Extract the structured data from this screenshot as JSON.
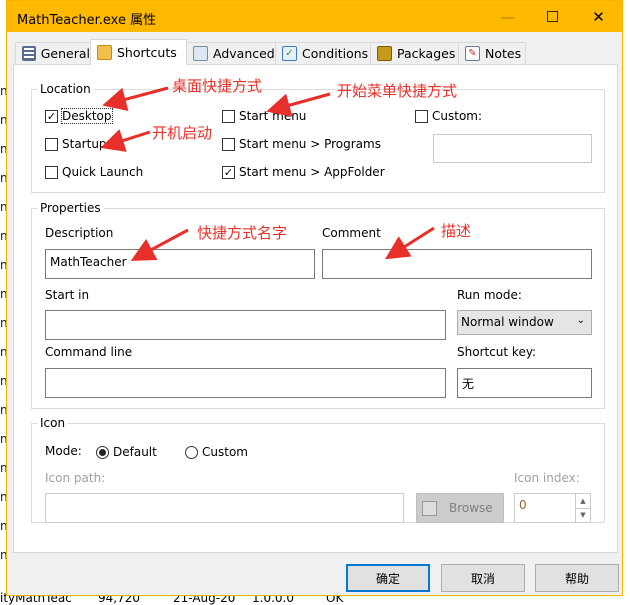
{
  "background": {
    "left_fragment": "ni",
    "bottom_row": [
      "ityMathTeac",
      "94,720",
      "21-Aug-20",
      "1.0.0.0",
      "OK"
    ]
  },
  "window": {
    "title": "MathTeacher.exe 属性",
    "accent": "#ffb900"
  },
  "tabs": [
    {
      "label": "General"
    },
    {
      "label": "Shortcuts",
      "selected": true
    },
    {
      "label": "Advanced"
    },
    {
      "label": "Conditions"
    },
    {
      "label": "Packages"
    },
    {
      "label": "Notes"
    }
  ],
  "location": {
    "legend": "Location",
    "items": [
      {
        "label": "Desktop",
        "checked": true
      },
      {
        "label": "Startup",
        "checked": false
      },
      {
        "label": "Quick Launch",
        "checked": false
      },
      {
        "label": "Start menu",
        "checked": false
      },
      {
        "label": "Start menu > Programs",
        "checked": false
      },
      {
        "label": "Start menu > AppFolder",
        "checked": true
      },
      {
        "label": "Custom:",
        "checked": false
      }
    ],
    "custom_value": ""
  },
  "properties": {
    "legend": "Properties",
    "description_label": "Description",
    "description_value": "MathTeacher",
    "comment_label": "Comment",
    "comment_value": "",
    "start_in_label": "Start in",
    "start_in_value": "",
    "run_mode_label": "Run mode:",
    "run_mode_value": "Normal window",
    "command_line_label": "Command line",
    "command_line_value": "",
    "shortcut_key_label": "Shortcut key:",
    "shortcut_key_value": "无"
  },
  "icon": {
    "legend": "Icon",
    "mode_label": "Mode:",
    "default_label": "Default",
    "custom_label": "Custom",
    "selected": "Default",
    "icon_path_label": "Icon path:",
    "icon_path_value": "",
    "browse_label": "Browse",
    "icon_index_label": "Icon index:",
    "icon_index_value": "0"
  },
  "buttons": {
    "ok": "确定",
    "cancel": "取消",
    "help": "帮助"
  },
  "annotations": {
    "desktop": "桌面快捷方式",
    "start_menu": "开始菜单快捷方式",
    "startup": "开机启动",
    "name": "快捷方式名字",
    "comment": "描述",
    "color": "#e8302a"
  }
}
